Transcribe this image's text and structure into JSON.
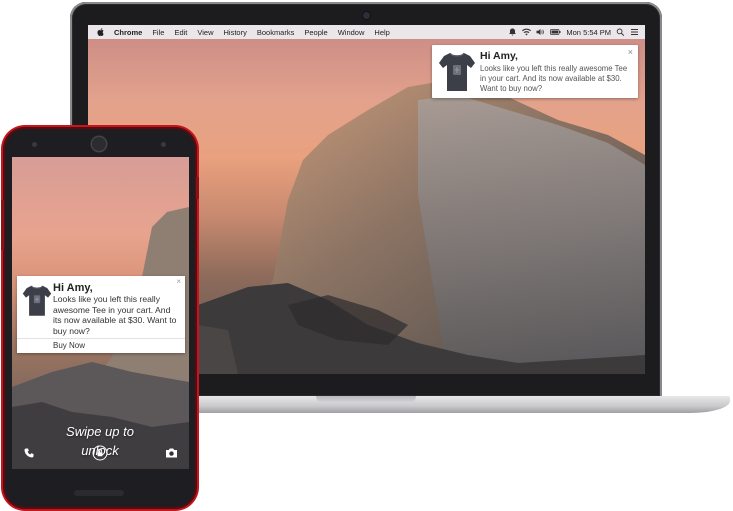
{
  "menubar": {
    "items": [
      "Chrome",
      "File",
      "Edit",
      "View",
      "History",
      "Bookmarks",
      "People",
      "Window",
      "Help"
    ],
    "clock": "Mon 5:54 PM",
    "status_icons": [
      "bell-icon",
      "wifi-icon",
      "volume-icon",
      "battery-icon",
      "search-icon",
      "list-icon"
    ]
  },
  "desktop_notification": {
    "title": "Hi Amy,",
    "body": "Looks like you left this really awesome Tee in your cart. And its now available at $30. Want to buy now?",
    "close": "×",
    "image_icon": "tshirt-icon"
  },
  "mobile_notification": {
    "title": "Hi Amy,",
    "body": "Looks like you left this really awesome Tee in your cart. And its now available at $30. Want to buy now?",
    "action": "Buy Now",
    "close": "×",
    "image_icon": "tshirt-icon"
  },
  "lockscreen": {
    "swipe_text": "Swipe up to unlock",
    "icons": [
      "phone-icon",
      "lock-icon",
      "camera-icon"
    ]
  },
  "colors": {
    "phone_accent": "#c4161c",
    "laptop_frame": "#1c1c1e"
  }
}
